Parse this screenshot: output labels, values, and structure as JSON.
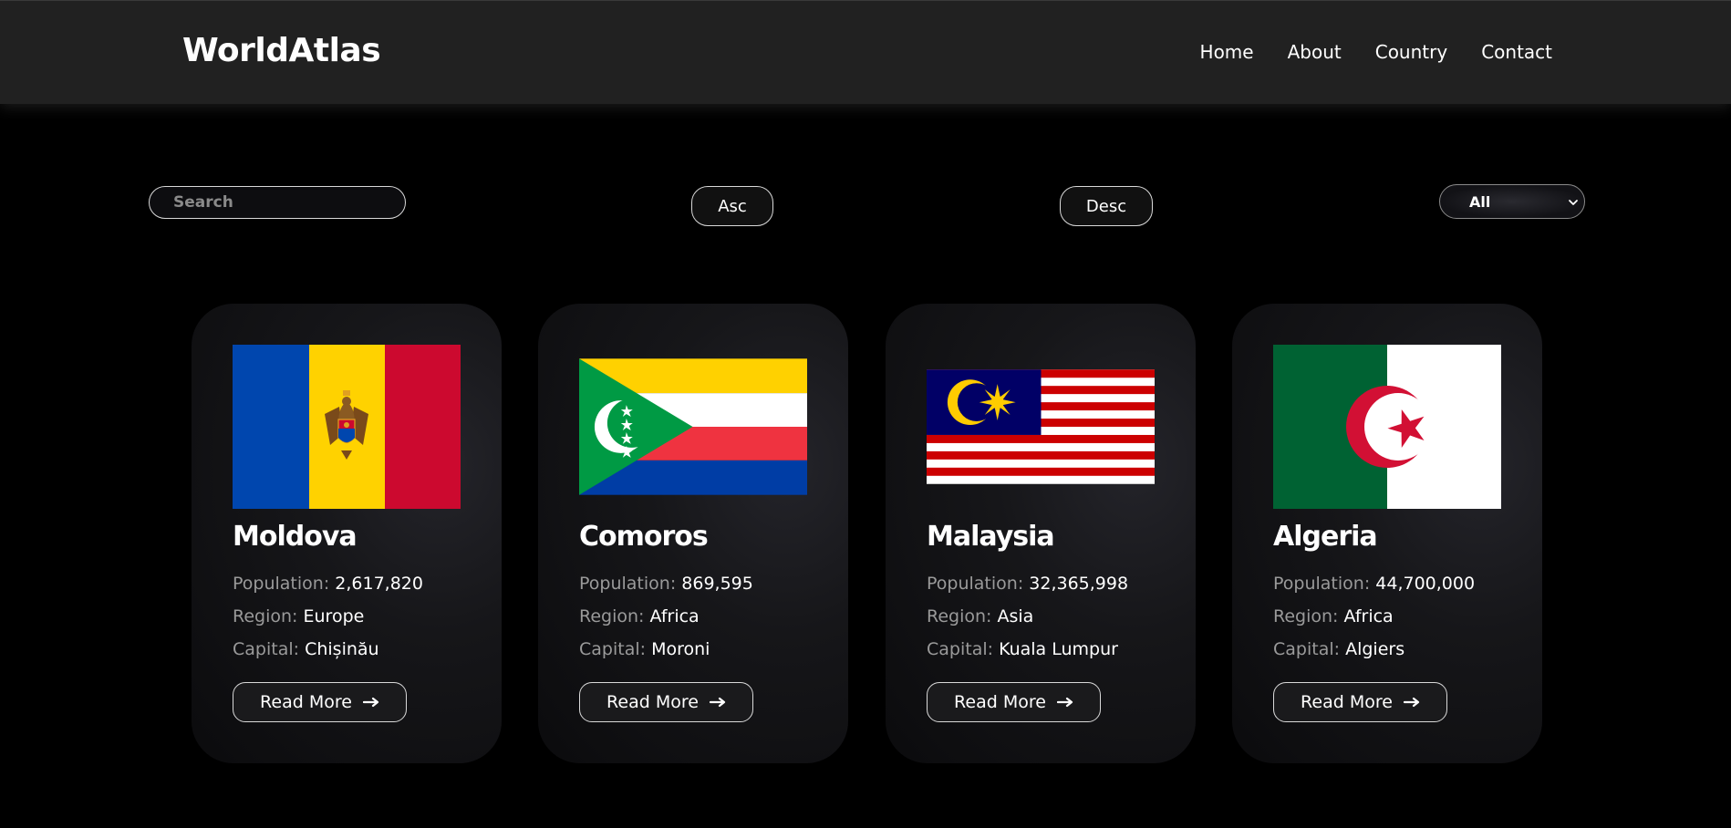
{
  "header": {
    "logo": "WorldAtlas",
    "nav": [
      "Home",
      "About",
      "Country",
      "Contact"
    ]
  },
  "controls": {
    "search_placeholder": "Search",
    "asc_label": "Asc",
    "desc_label": "Desc",
    "region_filter": "All"
  },
  "labels": {
    "population": "Population:",
    "region": "Region:",
    "capital": "Capital:",
    "read_more": "Read More"
  },
  "icons": {
    "read_more": "arrow-right-icon",
    "select": "chevron-down-icon"
  },
  "countries": [
    {
      "name": "Moldova",
      "population": "2,617,820",
      "region": "Europe",
      "capital": "Chișinău",
      "flag": "moldova-flag"
    },
    {
      "name": "Comoros",
      "population": "869,595",
      "region": "Africa",
      "capital": "Moroni",
      "flag": "comoros-flag"
    },
    {
      "name": "Malaysia",
      "population": "32,365,998",
      "region": "Asia",
      "capital": "Kuala Lumpur",
      "flag": "malaysia-flag"
    },
    {
      "name": "Algeria",
      "population": "44,700,000",
      "region": "Africa",
      "capital": "Algiers",
      "flag": "algeria-flag"
    }
  ],
  "colors": {
    "background": "#000000",
    "header": "#212121",
    "text": "#ffffff",
    "label": "#9a9a9a"
  }
}
